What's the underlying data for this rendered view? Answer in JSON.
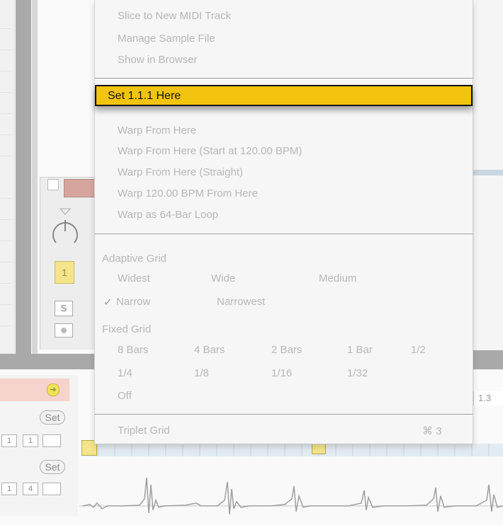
{
  "menu": {
    "top_items": [
      "Slice to New MIDI Track",
      "Manage Sample File",
      "Show in Browser"
    ],
    "highlighted": "Set 1.1.1 Here",
    "warp_items": [
      "Warp From Here",
      "Warp From Here (Start at 120.00 BPM)",
      "Warp From Here (Straight)",
      "Warp 120.00 BPM From Here",
      "Warp as 64-Bar Loop"
    ],
    "adaptive_grid": {
      "header": "Adaptive Grid",
      "row1": [
        "Widest",
        "Wide",
        "Medium"
      ],
      "row2": [
        "Narrow",
        "Narrowest"
      ],
      "checked": "Narrow",
      "check_mark": "✓"
    },
    "fixed_grid": {
      "header": "Fixed Grid",
      "row1": [
        "8 Bars",
        "4 Bars",
        "2 Bars",
        "1 Bar",
        "1/2"
      ],
      "row2": [
        "1/4",
        "1/8",
        "1/16",
        "1/32"
      ],
      "off": "Off"
    },
    "triplet": {
      "label": "Triplet Grid",
      "shortcut": "⌘ 3"
    }
  },
  "device": {
    "value_badge": "1",
    "solo": "S"
  },
  "clip": {
    "set_label": "Set",
    "box_values": [
      "1",
      "1",
      "1",
      "4"
    ],
    "ruler_label": "1.3"
  }
}
